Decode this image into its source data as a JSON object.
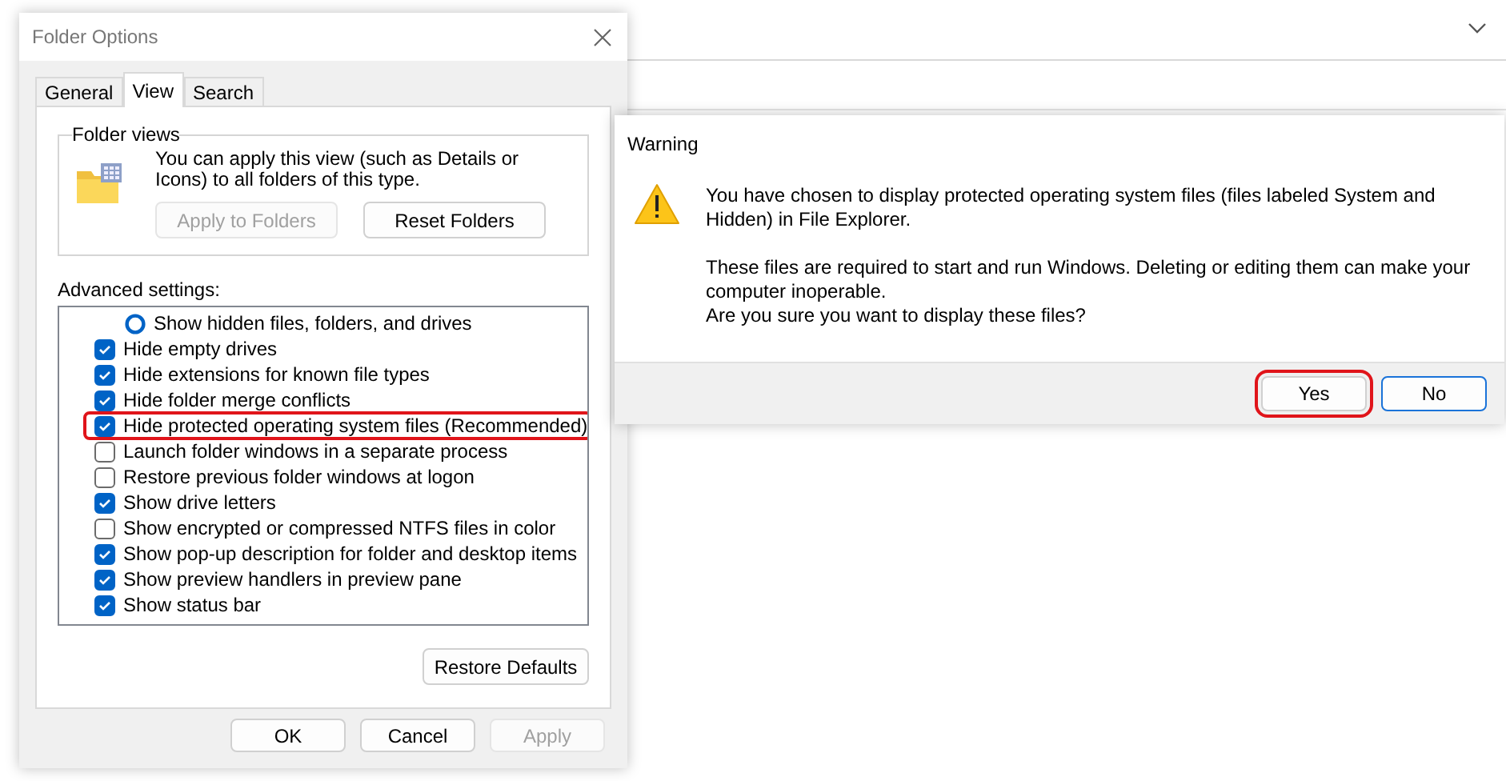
{
  "folder_options": {
    "title": "Folder Options",
    "tabs": [
      {
        "label": "General",
        "selected": false
      },
      {
        "label": "View",
        "selected": true
      },
      {
        "label": "Search",
        "selected": false
      }
    ],
    "folder_views": {
      "legend": "Folder views",
      "text": "You can apply this view (such as Details or Icons) to all folders of this type.",
      "buttons": [
        {
          "label": "Apply to Folders",
          "disabled": true
        },
        {
          "label": "Reset Folders",
          "disabled": false
        }
      ]
    },
    "advanced_label": "Advanced settings:",
    "settings": [
      {
        "kind": "radio",
        "label": "Show hidden files, folders, and drives",
        "checked": false,
        "highlighted": false
      },
      {
        "kind": "checkbox",
        "label": "Hide empty drives",
        "checked": true,
        "highlighted": false
      },
      {
        "kind": "checkbox",
        "label": "Hide extensions for known file types",
        "checked": true,
        "highlighted": false
      },
      {
        "kind": "checkbox",
        "label": "Hide folder merge conflicts",
        "checked": true,
        "highlighted": false
      },
      {
        "kind": "checkbox",
        "label": "Hide protected operating system files (Recommended)",
        "checked": true,
        "highlighted": true
      },
      {
        "kind": "checkbox",
        "label": "Launch folder windows in a separate process",
        "checked": false,
        "highlighted": false
      },
      {
        "kind": "checkbox",
        "label": "Restore previous folder windows at logon",
        "checked": false,
        "highlighted": false
      },
      {
        "kind": "checkbox",
        "label": "Show drive letters",
        "checked": true,
        "highlighted": false
      },
      {
        "kind": "checkbox",
        "label": "Show encrypted or compressed NTFS files in color",
        "checked": false,
        "highlighted": false
      },
      {
        "kind": "checkbox",
        "label": "Show pop-up description for folder and desktop items",
        "checked": true,
        "highlighted": false
      },
      {
        "kind": "checkbox",
        "label": "Show preview handlers in preview pane",
        "checked": true,
        "highlighted": false
      },
      {
        "kind": "checkbox",
        "label": "Show status bar",
        "checked": true,
        "highlighted": false
      }
    ],
    "restore_button": "Restore Defaults",
    "buttons": [
      {
        "label": "OK",
        "disabled": false
      },
      {
        "label": "Cancel",
        "disabled": false
      },
      {
        "label": "Apply",
        "disabled": true
      }
    ]
  },
  "warning": {
    "title": "Warning",
    "message": "You have chosen to display protected operating system files (files labeled System and Hidden) in File Explorer.",
    "details": "These files are required to start and run Windows. Deleting or editing them can make your computer inoperable.",
    "question": "Are you sure you want to display these files?",
    "buttons": [
      {
        "label": "Yes",
        "highlighted": true,
        "focused": false
      },
      {
        "label": "No",
        "highlighted": false,
        "focused": true
      }
    ]
  }
}
